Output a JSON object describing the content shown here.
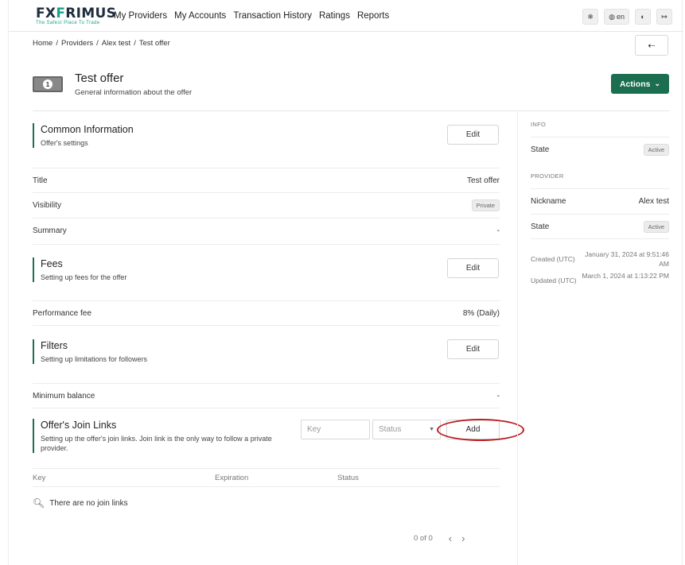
{
  "brand": {
    "name_a": "FX",
    "name_o": "F",
    "name_b": "RIMUS",
    "tagline": "The Safest Place To Trade"
  },
  "nav": {
    "links": [
      "My Providers",
      "My Accounts",
      "Transaction History",
      "Ratings",
      "Reports"
    ]
  },
  "top_buttons": {
    "language": "en"
  },
  "breadcrumb": [
    "Home",
    "/",
    "Providers",
    "/",
    "Alex test",
    "/",
    "Test offer"
  ],
  "header": {
    "title": "Test offer",
    "subtitle": "General information about the offer",
    "icon_text": "1",
    "actions_label": "Actions"
  },
  "common": {
    "title": "Common Information",
    "subtitle": "Offer's settings",
    "edit_label": "Edit",
    "rows": [
      {
        "label": "Title",
        "value": "Test offer"
      },
      {
        "label": "Visibility",
        "value": "Private"
      },
      {
        "label": "Summary",
        "value": "-"
      }
    ]
  },
  "fees": {
    "title": "Fees",
    "subtitle": "Setting up fees for the offer",
    "edit_label": "Edit",
    "rows": [
      {
        "label": "Performance fee",
        "value": "8% (Daily)"
      }
    ]
  },
  "filters": {
    "title": "Filters",
    "subtitle": "Setting up limitations for followers",
    "edit_label": "Edit",
    "rows": [
      {
        "label": "Minimum balance",
        "value": "-"
      }
    ]
  },
  "join_links": {
    "title": "Offer's Join Links",
    "subtitle": "Setting up the offer's join links. Join link is the only way to follow a private provider.",
    "key_placeholder": "Key",
    "status_placeholder": "Status",
    "add_label": "Add",
    "columns": [
      "Key",
      "Expiration",
      "Status"
    ],
    "empty_text": "There are no join links",
    "pager": "0 of 0"
  },
  "side": {
    "info_caption": "INFO",
    "info_state_label": "State",
    "info_state_value": "Active",
    "provider_caption": "PROVIDER",
    "nickname_label": "Nickname",
    "nickname_value": "Alex test",
    "provider_state_label": "State",
    "provider_state_value": "Active",
    "created_label": "Created (UTC)",
    "created_value": "January 31, 2024 at 9:51:46 AM",
    "updated_label": "Updated (UTC)",
    "updated_value": "March 1, 2024 at 1:13:22 PM"
  },
  "colors": {
    "accent": "#1b6e4f",
    "brand_teal": "#1aa38a",
    "highlight": "#b81c22"
  }
}
